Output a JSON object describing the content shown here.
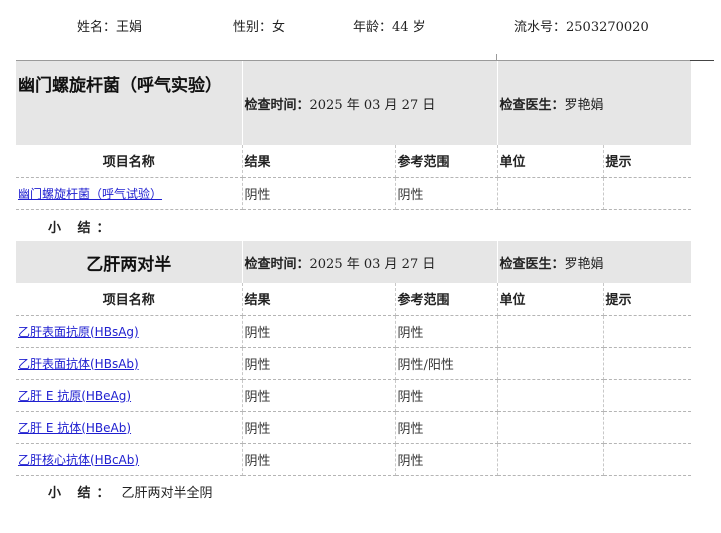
{
  "patient": {
    "name": "姓名：王娟",
    "gender": "性别：女",
    "age": "年龄：44 岁",
    "serial": "流水号：2503270020"
  },
  "sections": [
    {
      "title": "幽门螺旋杆菌（呼气实验）",
      "time_label": "检查时间：",
      "time_value": "2025 年 03 月 27 日",
      "doctor_label": "检查医生：",
      "doctor_value": "罗艳娟",
      "columns": [
        "项目名称",
        "结果",
        "参考范围",
        "单位",
        "提示"
      ],
      "rows": [
        {
          "name": "幽门螺旋杆菌（呼气试验）",
          "result": "阴性",
          "range": "阴性",
          "unit": "",
          "hint": ""
        }
      ],
      "summary_label": "小  结：",
      "summary_text": ""
    },
    {
      "title": "乙肝两对半",
      "time_label": "检查时间：",
      "time_value": "2025 年 03 月 27 日",
      "doctor_label": "检查医生：",
      "doctor_value": "罗艳娟",
      "columns": [
        "项目名称",
        "结果",
        "参考范围",
        "单位",
        "提示"
      ],
      "rows": [
        {
          "name": "乙肝表面抗原(HBsAg)",
          "result": "阴性",
          "range": "阴性",
          "unit": "",
          "hint": ""
        },
        {
          "name": "乙肝表面抗体(HBsAb)",
          "result": "阴性",
          "range": "阴性/阳性",
          "unit": "",
          "hint": ""
        },
        {
          "name": "乙肝 E 抗原(HBeAg)",
          "result": "阴性",
          "range": "阴性",
          "unit": "",
          "hint": ""
        },
        {
          "name": "乙肝 E 抗体(HBeAb)",
          "result": "阴性",
          "range": "阴性",
          "unit": "",
          "hint": ""
        },
        {
          "name": "乙肝核心抗体(HBcAb)",
          "result": "阴性",
          "range": "阴性",
          "unit": "",
          "hint": ""
        }
      ],
      "summary_label": "小  结：",
      "summary_text": "乙肝两对半全阴"
    }
  ]
}
